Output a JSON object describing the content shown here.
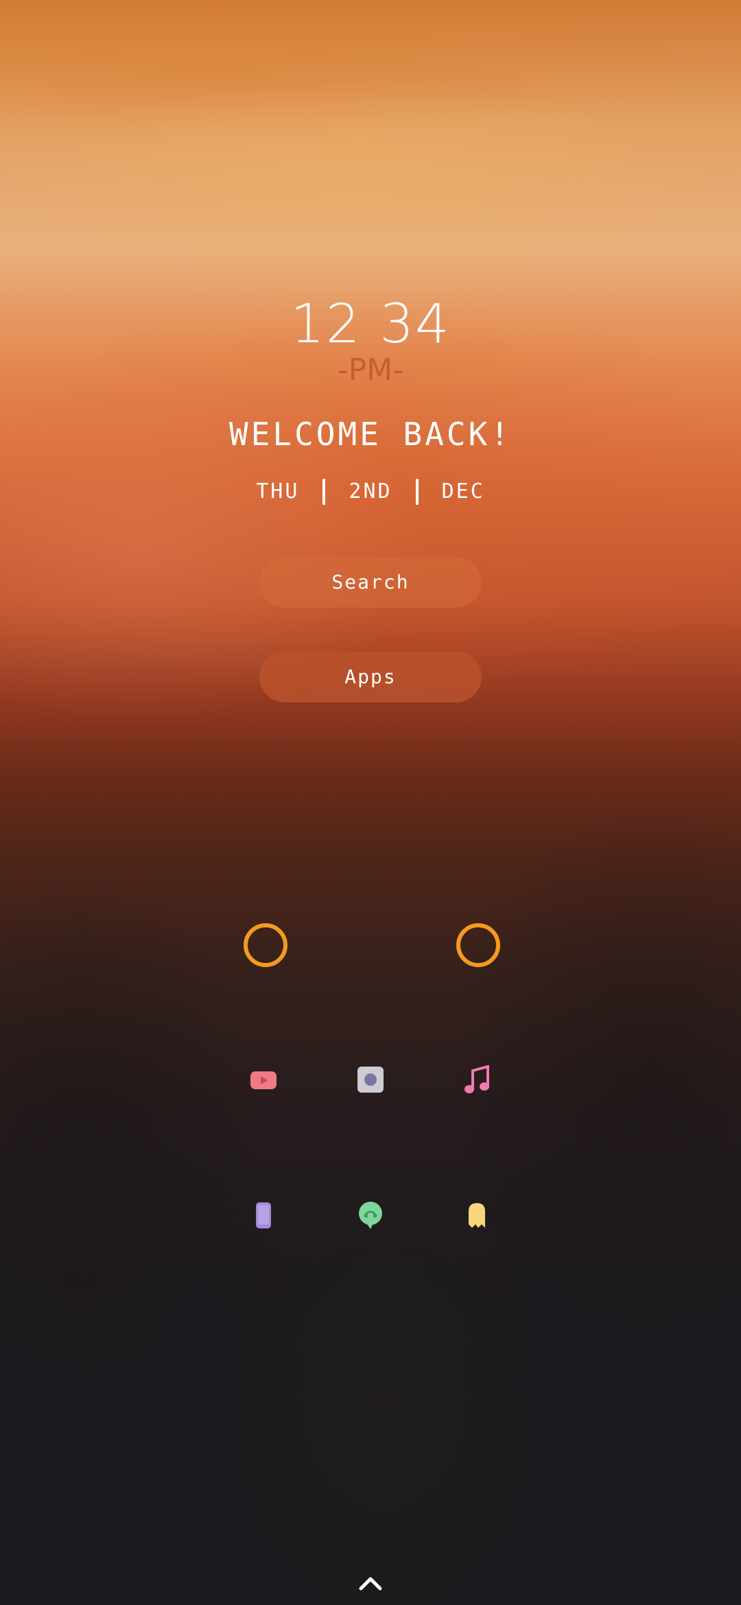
{
  "clock": {
    "time": "12 34",
    "period": "-PM-"
  },
  "greeting": "WELCOME BACK!",
  "date": {
    "day": "THU",
    "date": "2ND",
    "month": "DEC"
  },
  "buttons": {
    "search_label": "Search",
    "apps_label": "Apps"
  },
  "widgets": [
    {
      "icon": "ring-icon",
      "color": "#f29b1e"
    },
    {
      "icon": "ring-icon",
      "color": "#f29b1e"
    }
  ],
  "dock": {
    "row1": [
      {
        "icon": "youtube-icon",
        "color": "#f07b86"
      },
      {
        "icon": "camera-icon",
        "color": "#c9c5cc"
      },
      {
        "icon": "music-icon",
        "color": "#f07bb0"
      }
    ],
    "row2": [
      {
        "icon": "phone-icon",
        "color": "#a58ad8"
      },
      {
        "icon": "chat-icon",
        "color": "#7fd69a"
      },
      {
        "icon": "ghost-icon",
        "color": "#f7d77a"
      }
    ]
  },
  "navigation": {
    "icon": "chevron-up-icon"
  }
}
